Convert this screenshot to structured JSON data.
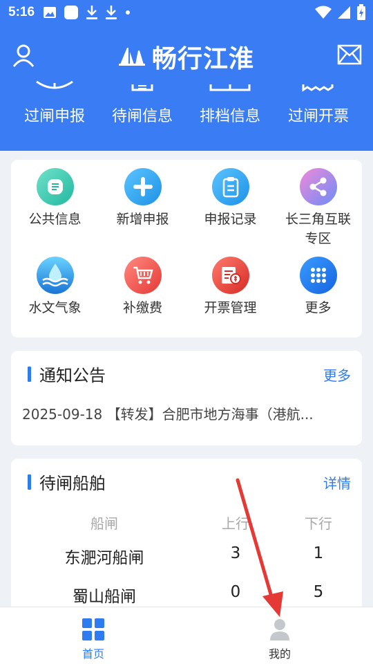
{
  "status_bar": {
    "time": "5:16"
  },
  "app_bar": {
    "title": "畅行江淮"
  },
  "quick_actions": [
    {
      "label": "过闸申报",
      "icon": "report-icon"
    },
    {
      "label": "待闸信息",
      "icon": "calendar-icon"
    },
    {
      "label": "排档信息",
      "icon": "schedule-icon"
    },
    {
      "label": "过闸开票",
      "icon": "ticket-icon"
    }
  ],
  "grid": [
    {
      "label": "公共信息",
      "icon": "public-info-icon",
      "color": "#2fc9b0"
    },
    {
      "label": "新增申报",
      "icon": "plus-icon",
      "color": "#2aa3ee"
    },
    {
      "label": "申报记录",
      "icon": "clipboard-icon",
      "color": "#2aa3ee"
    },
    {
      "label": "长三角互联",
      "label2": "专区",
      "icon": "share-icon",
      "color": "#a77cf2"
    },
    {
      "label": "水文气象",
      "icon": "water-drop-icon",
      "color": "#2e8de6"
    },
    {
      "label": "补缴费",
      "icon": "cart-icon",
      "color": "#ef5454"
    },
    {
      "label": "开票管理",
      "icon": "invoice-icon",
      "color": "#e9453f"
    },
    {
      "label": "更多",
      "icon": "more-icon",
      "color": "#2378ee"
    }
  ],
  "notice": {
    "title": "通知公告",
    "more": "更多",
    "item": "2025-09-18 【转发】合肥市地方海事（港航..."
  },
  "waiting": {
    "title": "待闸船舶",
    "more": "详情",
    "headers": [
      "船闸",
      "上行",
      "下行"
    ],
    "rows": [
      {
        "name": "东淝河船闸",
        "up": "3",
        "down": "1"
      },
      {
        "name": "蜀山船闸",
        "up": "0",
        "down": "5"
      }
    ]
  },
  "tabs": [
    {
      "label": "首页",
      "icon": "home-grid-icon"
    },
    {
      "label": "我的",
      "icon": "profile-icon"
    }
  ],
  "colors": {
    "primary": "#3a7cf3",
    "accent": "#2f7bf0",
    "annotation": "#e53935"
  }
}
